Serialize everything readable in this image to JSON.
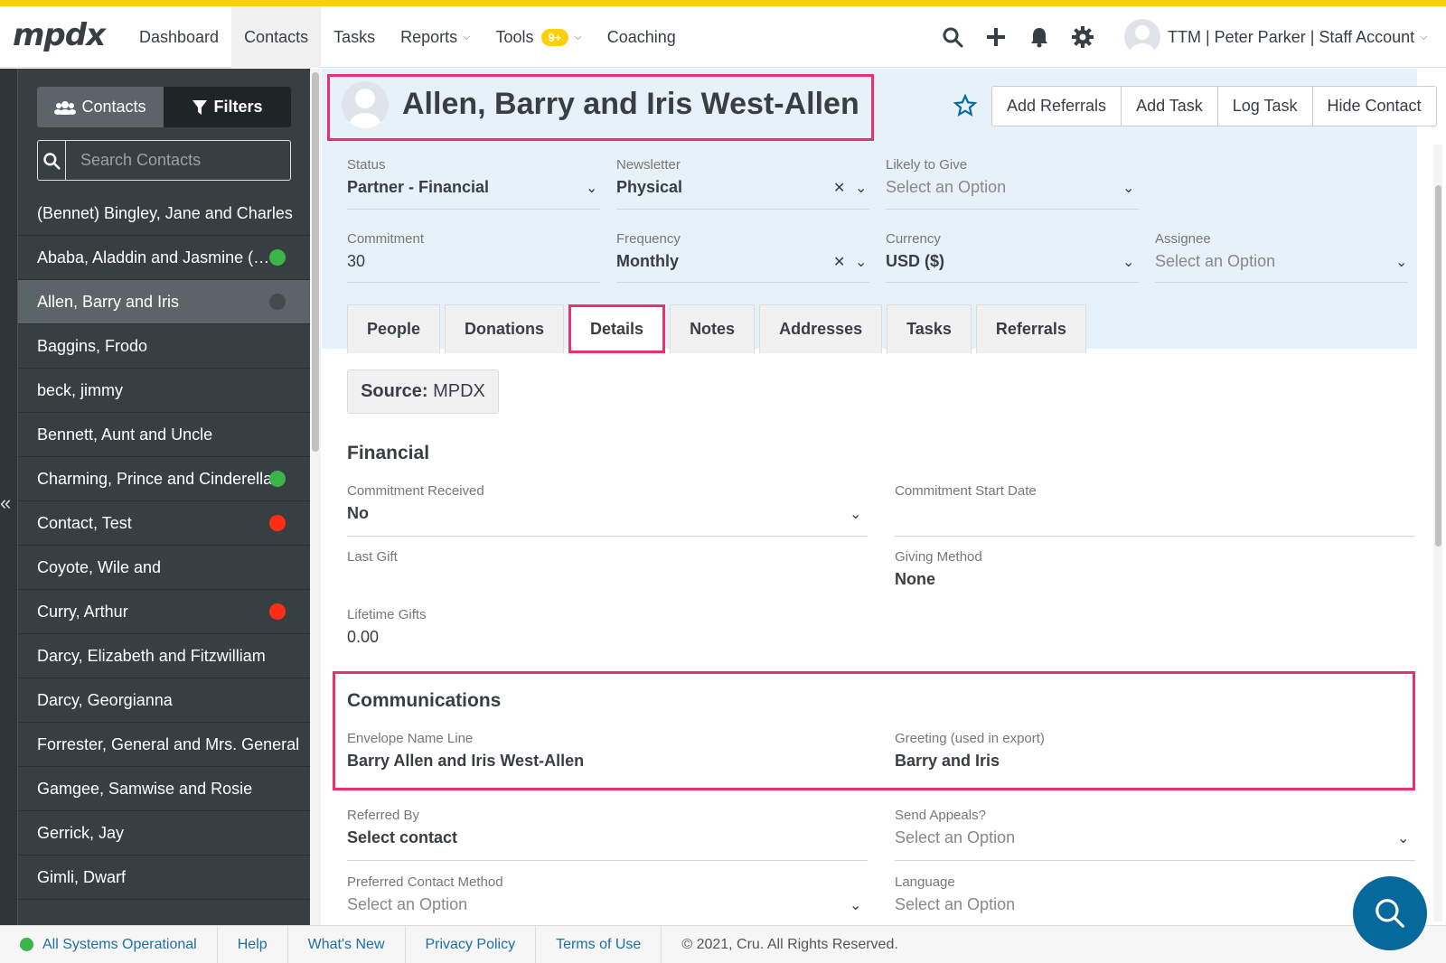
{
  "app": {
    "logo_text": "mpdx",
    "colors": {
      "accent": "#ffcf07",
      "highlight": "#e6336f",
      "sidebar": "#383f43",
      "link": "#1c6fa8"
    }
  },
  "nav": {
    "items": [
      {
        "label": "Dashboard"
      },
      {
        "label": "Contacts"
      },
      {
        "label": "Tasks"
      },
      {
        "label": "Reports"
      },
      {
        "label": "Tools"
      },
      {
        "label": "Coaching"
      }
    ],
    "tools_badge": "9+",
    "account_label": "TTM | Peter Parker | Staff Account"
  },
  "sidebar": {
    "contacts_button": "Contacts",
    "filters_button": "Filters",
    "search_placeholder": "Search Contacts",
    "contacts": [
      {
        "name": "(Bennet) Bingley, Jane and Charles"
      },
      {
        "name": "Ababa, Aladdin and Jasmine (…"
      },
      {
        "name": "Allen, Barry and Iris"
      },
      {
        "name": "Baggins, Frodo"
      },
      {
        "name": "beck, jimmy"
      },
      {
        "name": "Bennett, Aunt and Uncle"
      },
      {
        "name": "Charming, Prince and Cinderella"
      },
      {
        "name": "Contact, Test"
      },
      {
        "name": "Coyote, Wile and"
      },
      {
        "name": "Curry, Arthur"
      },
      {
        "name": "Darcy, Elizabeth and Fitzwilliam"
      },
      {
        "name": "Darcy, Georgianna"
      },
      {
        "name": "Forrester, General and Mrs. General"
      },
      {
        "name": "Gamgee, Samwise and Rosie"
      },
      {
        "name": "Gerrick, Jay"
      },
      {
        "name": "Gimli, Dwarf"
      }
    ]
  },
  "contact": {
    "name": "Allen, Barry and Iris West-Allen",
    "actions": [
      "Add Referrals",
      "Add Task",
      "Log Task",
      "Hide Contact"
    ],
    "fields": {
      "status": {
        "label": "Status",
        "value": "Partner - Financial"
      },
      "newsletter": {
        "label": "Newsletter",
        "value": "Physical"
      },
      "likely": {
        "label": "Likely to Give",
        "value": "Select an Option"
      },
      "commitment": {
        "label": "Commitment",
        "value": "30"
      },
      "frequency": {
        "label": "Frequency",
        "value": "Monthly"
      },
      "currency": {
        "label": "Currency",
        "value": "USD ($)"
      },
      "assignee": {
        "label": "Assignee",
        "value": "Select an Option"
      }
    },
    "tabs": [
      "People",
      "Donations",
      "Details",
      "Notes",
      "Addresses",
      "Tasks",
      "Referrals"
    ],
    "active_tab": "Details"
  },
  "details": {
    "source_label": "Source:",
    "source_value": "MPDX",
    "financial_title": "Financial",
    "commitment_received": {
      "label": "Commitment Received",
      "value": "No"
    },
    "commitment_start": {
      "label": "Commitment Start Date",
      "value": ""
    },
    "last_gift": {
      "label": "Last Gift",
      "value": ""
    },
    "giving_method": {
      "label": "Giving Method",
      "value": "None"
    },
    "lifetime_gifts": {
      "label": "Lifetime Gifts",
      "value": "0.00"
    },
    "communications_title": "Communications",
    "envelope": {
      "label": "Envelope Name Line",
      "value": "Barry Allen and Iris West-Allen"
    },
    "greeting": {
      "label": "Greeting (used in export)",
      "value": "Barry and Iris"
    },
    "referred_by": {
      "label": "Referred By",
      "value": "Select contact"
    },
    "send_appeals": {
      "label": "Send Appeals?",
      "value": "Select an Option"
    },
    "preferred_method": {
      "label": "Preferred Contact Method",
      "value": "Select an Option"
    },
    "language": {
      "label": "Language",
      "value": "Select an Option"
    }
  },
  "footer": {
    "status": "All Systems Operational",
    "links": [
      "Help",
      "What's New",
      "Privacy Policy",
      "Terms of Use"
    ],
    "copyright": "© 2021, Cru. All Rights Reserved."
  }
}
